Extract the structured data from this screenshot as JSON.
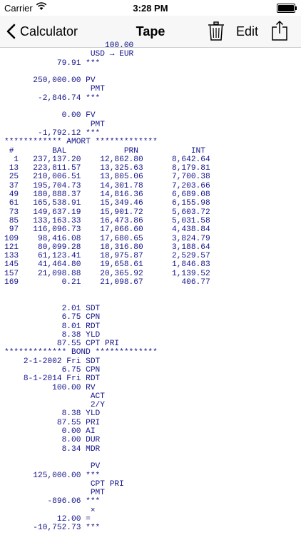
{
  "status_bar": {
    "carrier": "Carrier",
    "time": "3:28 PM"
  },
  "nav": {
    "back_label": "Calculator",
    "title": "Tape",
    "edit_label": "Edit"
  },
  "tape": {
    "lines": [
      "                     100.00",
      "                  USD → EUR",
      "           79.91 ***",
      "",
      "      250,000.00 PV",
      "                  PMT",
      "       -2,846.74 ***",
      "",
      "            0.00 FV",
      "                  PMT",
      "       -1,792.12 ***",
      "************ AMORT *************",
      " #        BAL            PRN           INT",
      "  1   237,137.20    12,862.80      8,642.64",
      " 13   223,811.57    13,325.63      8,179.81",
      " 25   210,006.51    13,805.06      7,700.38",
      " 37   195,704.73    14,301.78      7,203.66",
      " 49   180,888.37    14,816.36      6,689.08",
      " 61   165,538.91    15,349.46      6,155.98",
      " 73   149,637.19    15,901.72      5,603.72",
      " 85   133,163.33    16,473.86      5,031.58",
      " 97   116,096.73    17,066.60      4,438.84",
      "109    98,416.08    17,680.65      3,824.79",
      "121    80,099.28    18,316.80      3,188.64",
      "133    61,123.41    18,975.87      2,529.57",
      "145    41,464.80    19,658.61      1,846.83",
      "157    21,098.88    20,365.92      1,139.52",
      "169         0.21    21,098.67        406.77",
      "",
      "",
      "            2.01 SDT",
      "            6.75 CPN",
      "            8.01 RDT",
      "            8.38 YLD",
      "           87.55 CPT PRI",
      "************* BOND *************",
      "    2-1-2002 Fri SDT",
      "            6.75 CPN",
      "    8-1-2014 Fri RDT",
      "          100.00 RV",
      "                  ACT",
      "                  2/Y",
      "            8.38 YLD",
      "           87.55 PRI",
      "            0.00 AI",
      "            8.00 DUR",
      "            8.34 MDR",
      "",
      "                  PV",
      "      125,000.00 ***",
      "                  CPT PRI",
      "                  PMT",
      "         -896.06 ***",
      "                  ×",
      "           12.00 =",
      "      -10,752.73 ***"
    ]
  }
}
